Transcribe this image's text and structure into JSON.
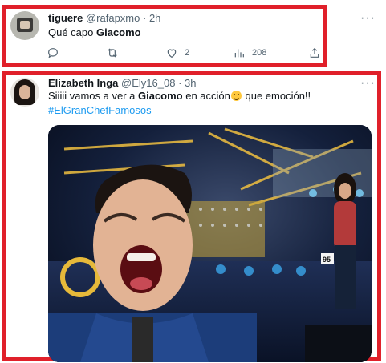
{
  "tweets": [
    {
      "name": "tiguere",
      "handle": "@rafapxmo",
      "separator": "·",
      "time": "2h",
      "text_before": "Qué capo ",
      "text_bold": "Giacomo",
      "actions": {
        "likes": "2",
        "views": "208"
      }
    },
    {
      "name": "Elizabeth Inga",
      "handle": "@Ely16_08",
      "separator": "·",
      "time": "3h",
      "text_before": "Siiiii vamos a ver a ",
      "text_bold": "Giacomo",
      "text_after": " en acción",
      "text_after_emoji": " que emoción!!",
      "emoji": "grinning-squinting-face",
      "hashtag": "#ElGranChefFamosos",
      "media_label": "95"
    }
  ],
  "icons": [
    "reply-icon",
    "retweet-icon",
    "like-icon",
    "views-icon",
    "share-icon",
    "more-icon"
  ],
  "colors": {
    "highlight_border": "#e0202a",
    "link": "#1d9bf0",
    "secondary_text": "#536471"
  }
}
